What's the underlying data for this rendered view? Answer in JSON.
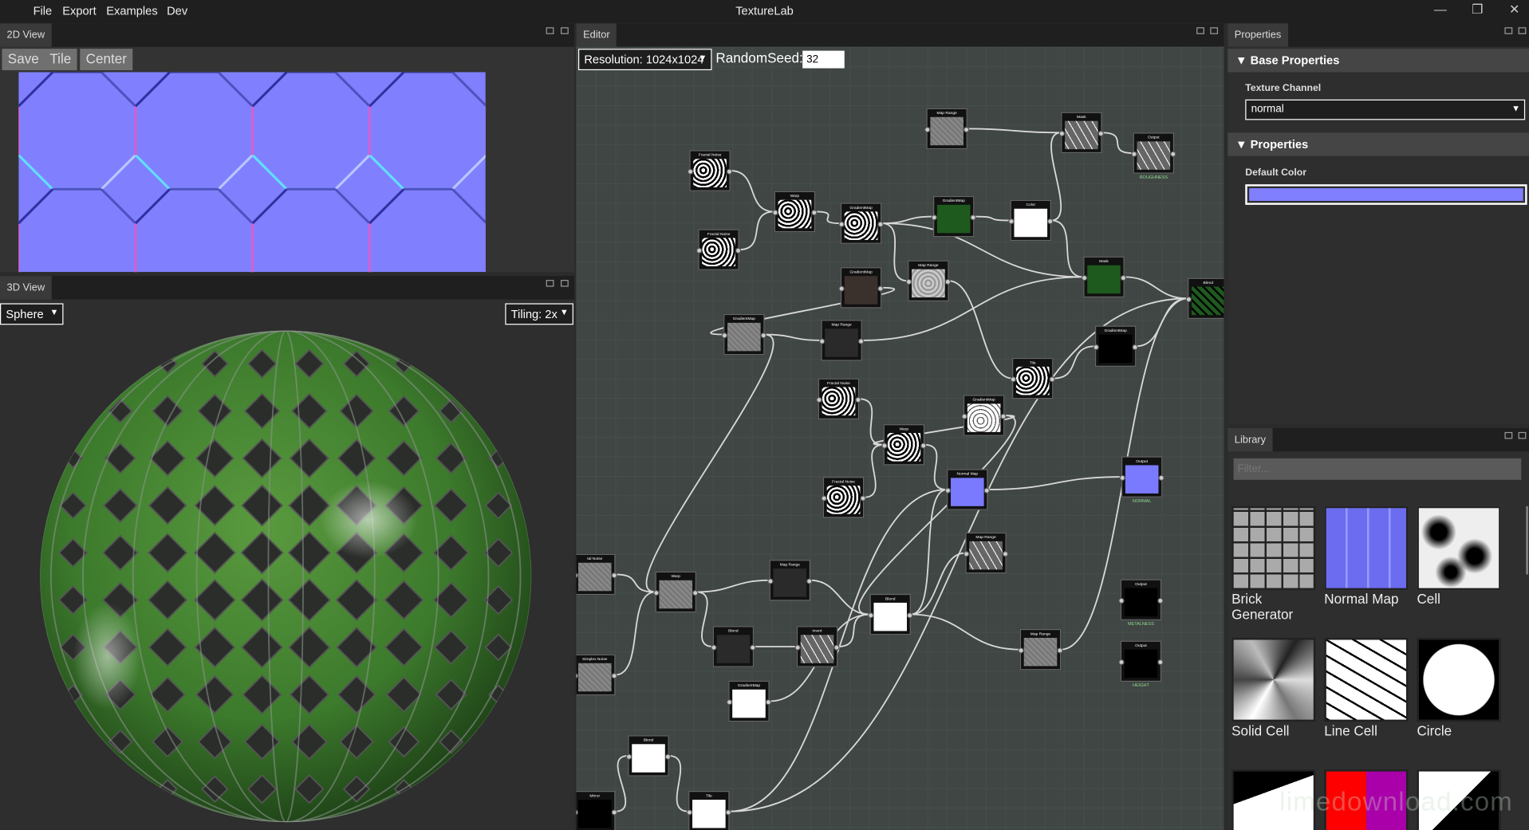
{
  "app": {
    "title": "TextureLab",
    "menu": [
      "File",
      "Export",
      "Examples",
      "Dev"
    ],
    "window_controls": {
      "minimize": "—",
      "maximize": "❐",
      "close": "✕"
    }
  },
  "view2d": {
    "tab": "2D View",
    "buttons": {
      "save": "Save",
      "tile": "Tile",
      "center": "Center"
    }
  },
  "view3d": {
    "tab": "3D View",
    "shape": "Sphere",
    "tiling": "Tiling: 2x"
  },
  "editor": {
    "tab": "Editor",
    "resolution": "Resolution: 1024x1024",
    "seed_label": "RandomSeed:",
    "seed_value": "32",
    "nodes": [
      {
        "id": "n1",
        "title": "Fractal Noise",
        "tex": "noise"
      },
      {
        "id": "n2",
        "title": "Fractal Noise",
        "tex": "noise"
      },
      {
        "id": "n3",
        "title": "Warp",
        "tex": "noise"
      },
      {
        "id": "n4",
        "title": "GradientMap",
        "tex": "noise"
      },
      {
        "id": "n5",
        "title": "Map Range",
        "tex": "gray"
      },
      {
        "id": "n6",
        "title": "Mask",
        "tex": "pattern"
      },
      {
        "id": "n7",
        "title": "Output",
        "tex": "pattern",
        "label": "ROUGHNESS"
      },
      {
        "id": "n8",
        "title": "GradientMap",
        "tex": "green"
      },
      {
        "id": "n9",
        "title": "Color",
        "tex": "white"
      },
      {
        "id": "n10",
        "title": "GradientMap",
        "tex": "brown"
      },
      {
        "id": "n11",
        "title": "Map Range",
        "tex": "lightnoise"
      },
      {
        "id": "n12",
        "title": "Mask",
        "tex": "green"
      },
      {
        "id": "n13",
        "title": "Blend",
        "tex": "greentile"
      },
      {
        "id": "n14",
        "title": "GradientMap",
        "tex": "gray"
      },
      {
        "id": "n15",
        "title": "Map Range",
        "tex": "dark"
      },
      {
        "id": "n16",
        "title": "GradientMap",
        "tex": "black"
      },
      {
        "id": "n17",
        "title": "Fractal Noise",
        "tex": "noise"
      },
      {
        "id": "n18",
        "title": "Tile",
        "tex": "noise"
      },
      {
        "id": "n19",
        "title": "GradientMap",
        "tex": "whitenoise"
      },
      {
        "id": "n20",
        "title": "Warp",
        "tex": "noise"
      },
      {
        "id": "n21",
        "title": "Normal Map",
        "tex": "normal"
      },
      {
        "id": "n22",
        "title": "Output",
        "tex": "normal",
        "label": "NORMAL"
      },
      {
        "id": "n23",
        "title": "Fractal Noise",
        "tex": "noise"
      },
      {
        "id": "n24",
        "title": "Map Range",
        "tex": "pattern"
      },
      {
        "id": "n25",
        "title": "tal Noise",
        "tex": "gray"
      },
      {
        "id": "n26",
        "title": "Warp",
        "tex": "gray"
      },
      {
        "id": "n27",
        "title": "Map Range",
        "tex": "dark"
      },
      {
        "id": "n28",
        "title": "Blend",
        "tex": "white"
      },
      {
        "id": "n29",
        "title": "Output",
        "tex": "black",
        "label": "METALNESS"
      },
      {
        "id": "n30",
        "title": "Blend",
        "tex": "dark"
      },
      {
        "id": "n31",
        "title": "Invert",
        "tex": "pattern"
      },
      {
        "id": "n32",
        "title": "Simplex Noise",
        "tex": "gray"
      },
      {
        "id": "n33",
        "title": "Map Range",
        "tex": "gray"
      },
      {
        "id": "n34",
        "title": "Output",
        "tex": "black",
        "label": "HEIGHT"
      },
      {
        "id": "n35",
        "title": "GradientMap",
        "tex": "white"
      },
      {
        "id": "n36",
        "title": "Blend",
        "tex": "white"
      },
      {
        "id": "n37",
        "title": "Mirror",
        "tex": "black"
      },
      {
        "id": "n38",
        "title": "Tile",
        "tex": "white"
      }
    ]
  },
  "properties": {
    "tab": "Properties",
    "section1": "Base Properties",
    "channel_label": "Texture Channel",
    "channel_value": "normal",
    "section2": "Properties",
    "color_label": "Default Color",
    "default_color": "#8080ff"
  },
  "library": {
    "tab": "Library",
    "filter_placeholder": "Filter...",
    "items": [
      {
        "name": "Brick Generator",
        "icon": "brick"
      },
      {
        "name": "Normal Map",
        "icon": "normal"
      },
      {
        "name": "Cell",
        "icon": "cell"
      },
      {
        "name": "Solid Cell",
        "icon": "solidcell"
      },
      {
        "name": "Line Cell",
        "icon": "linecell"
      },
      {
        "name": "Circle",
        "icon": "circle"
      },
      {
        "name": "",
        "icon": "shape"
      },
      {
        "name": "",
        "icon": "color"
      },
      {
        "name": "",
        "icon": "split"
      }
    ]
  },
  "watermark": "limedownload.com",
  "colors": {
    "normal_base": "#8080ff",
    "sphere_green": "#3f7f2f",
    "editor_bg": "#3f4643"
  }
}
